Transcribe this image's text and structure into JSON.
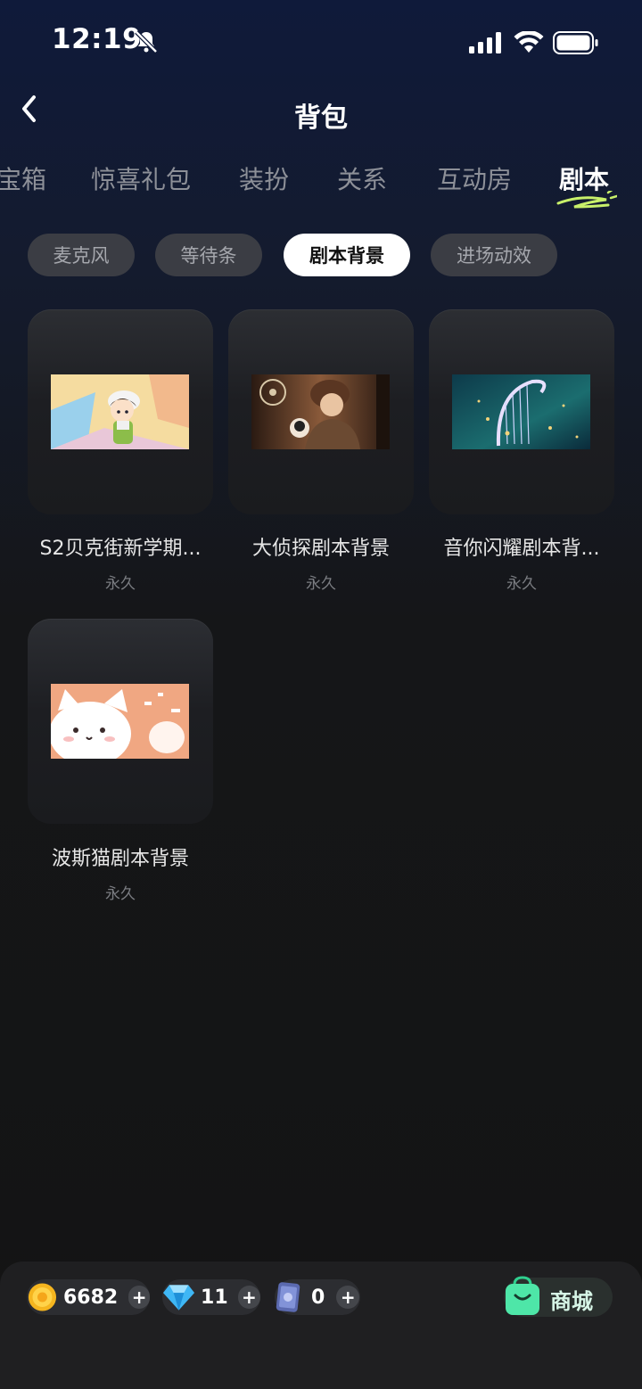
{
  "status": {
    "time": "12:19"
  },
  "nav": {
    "title": "背包"
  },
  "tabs": [
    {
      "label": "宝箱",
      "active": false
    },
    {
      "label": "惊喜礼包",
      "active": false
    },
    {
      "label": "装扮",
      "active": false
    },
    {
      "label": "关系",
      "active": false
    },
    {
      "label": "互动房",
      "active": false
    },
    {
      "label": "剧本",
      "active": true
    }
  ],
  "chips": [
    {
      "label": "麦克风",
      "active": false
    },
    {
      "label": "等待条",
      "active": false
    },
    {
      "label": "剧本背景",
      "active": true
    },
    {
      "label": "进场动效",
      "active": false
    }
  ],
  "items": [
    {
      "name": "S2贝克街新学期...",
      "duration": "永久",
      "thumb": "schoolboy-scene"
    },
    {
      "name": "大侦探剧本背景",
      "duration": "永久",
      "thumb": "detective-scene"
    },
    {
      "name": "音你闪耀剧本背...",
      "duration": "永久",
      "thumb": "harp-scene"
    },
    {
      "name": "波斯猫剧本背景",
      "duration": "永久",
      "thumb": "white-cat-scene"
    }
  ],
  "footer": {
    "coins": "6682",
    "diamonds": "11",
    "cards": "0",
    "shop_label": "商城"
  },
  "colors": {
    "accent_green": "#4ee6a8",
    "chip_bg": "#3b3d44",
    "chip_active_bg": "#ffffff"
  }
}
